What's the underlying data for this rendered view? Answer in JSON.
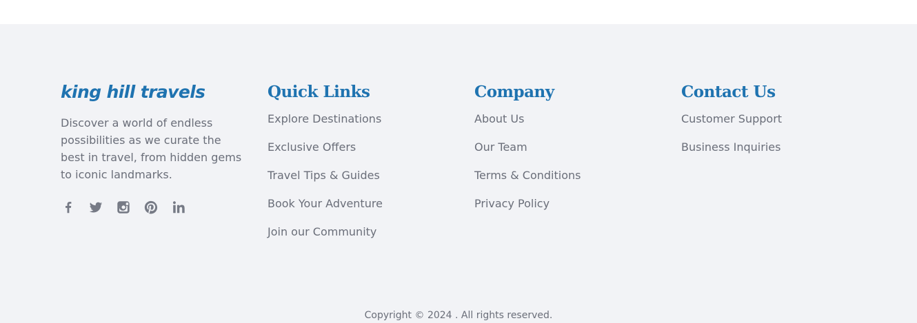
{
  "brand": {
    "name": "king hill travels",
    "description": "Discover a world of endless possibilities as we curate the best in travel, from hidden gems to iconic landmarks."
  },
  "social": [
    {
      "icon": "facebook-icon"
    },
    {
      "icon": "twitter-icon"
    },
    {
      "icon": "instagram-icon"
    },
    {
      "icon": "pinterest-icon"
    },
    {
      "icon": "linkedin-icon"
    }
  ],
  "quick_links": {
    "title": "Quick Links",
    "items": [
      {
        "label": "Explore Destinations"
      },
      {
        "label": "Exclusive Offers"
      },
      {
        "label": "Travel Tips & Guides"
      },
      {
        "label": "Book Your Adventure"
      },
      {
        "label": "Join our Community"
      }
    ]
  },
  "company": {
    "title": "Company",
    "items": [
      {
        "label": "About Us"
      },
      {
        "label": "Our Team"
      },
      {
        "label": "Terms & Conditions"
      },
      {
        "label": "Privacy Policy"
      }
    ]
  },
  "contact": {
    "title": "Contact Us",
    "items": [
      {
        "label": "Customer Support"
      },
      {
        "label": "Business Inquiries"
      }
    ]
  },
  "copyright": "Copyright © 2024 . All rights reserved.",
  "colors": {
    "accent": "#1f73b0",
    "text": "#6a6e79",
    "footer_bg": "#f2f3f6"
  }
}
